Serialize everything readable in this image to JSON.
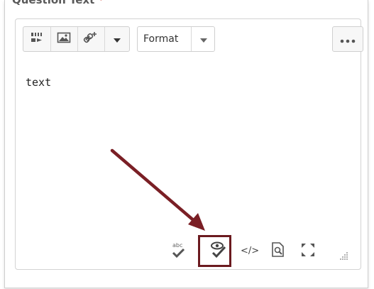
{
  "field": {
    "label": "Question Text",
    "required_mark": "*"
  },
  "toolbar": {
    "insert_stuff_icon": "insert-stuff-icon",
    "insert_image_icon": "insert-image-icon",
    "insert_link_icon": "insert-quicklink-icon",
    "insert_dropdown_icon": "caret-down-icon",
    "format_label": "Format",
    "format_dropdown_icon": "caret-down-icon",
    "more_icon": "ellipsis-icon"
  },
  "content": {
    "text": "text"
  },
  "status_bar": {
    "items": [
      {
        "name": "spellcheck-icon",
        "label": "abc"
      },
      {
        "name": "accessibility-checker-icon",
        "label": ""
      },
      {
        "name": "source-code-icon",
        "label": "</>"
      },
      {
        "name": "preview-icon",
        "label": ""
      },
      {
        "name": "fullscreen-icon",
        "label": ""
      },
      {
        "name": "resize-handle-icon",
        "label": ""
      }
    ]
  },
  "annotation": {
    "arrow_color": "#7a1f25",
    "highlight_color": "#6b1a1f"
  }
}
